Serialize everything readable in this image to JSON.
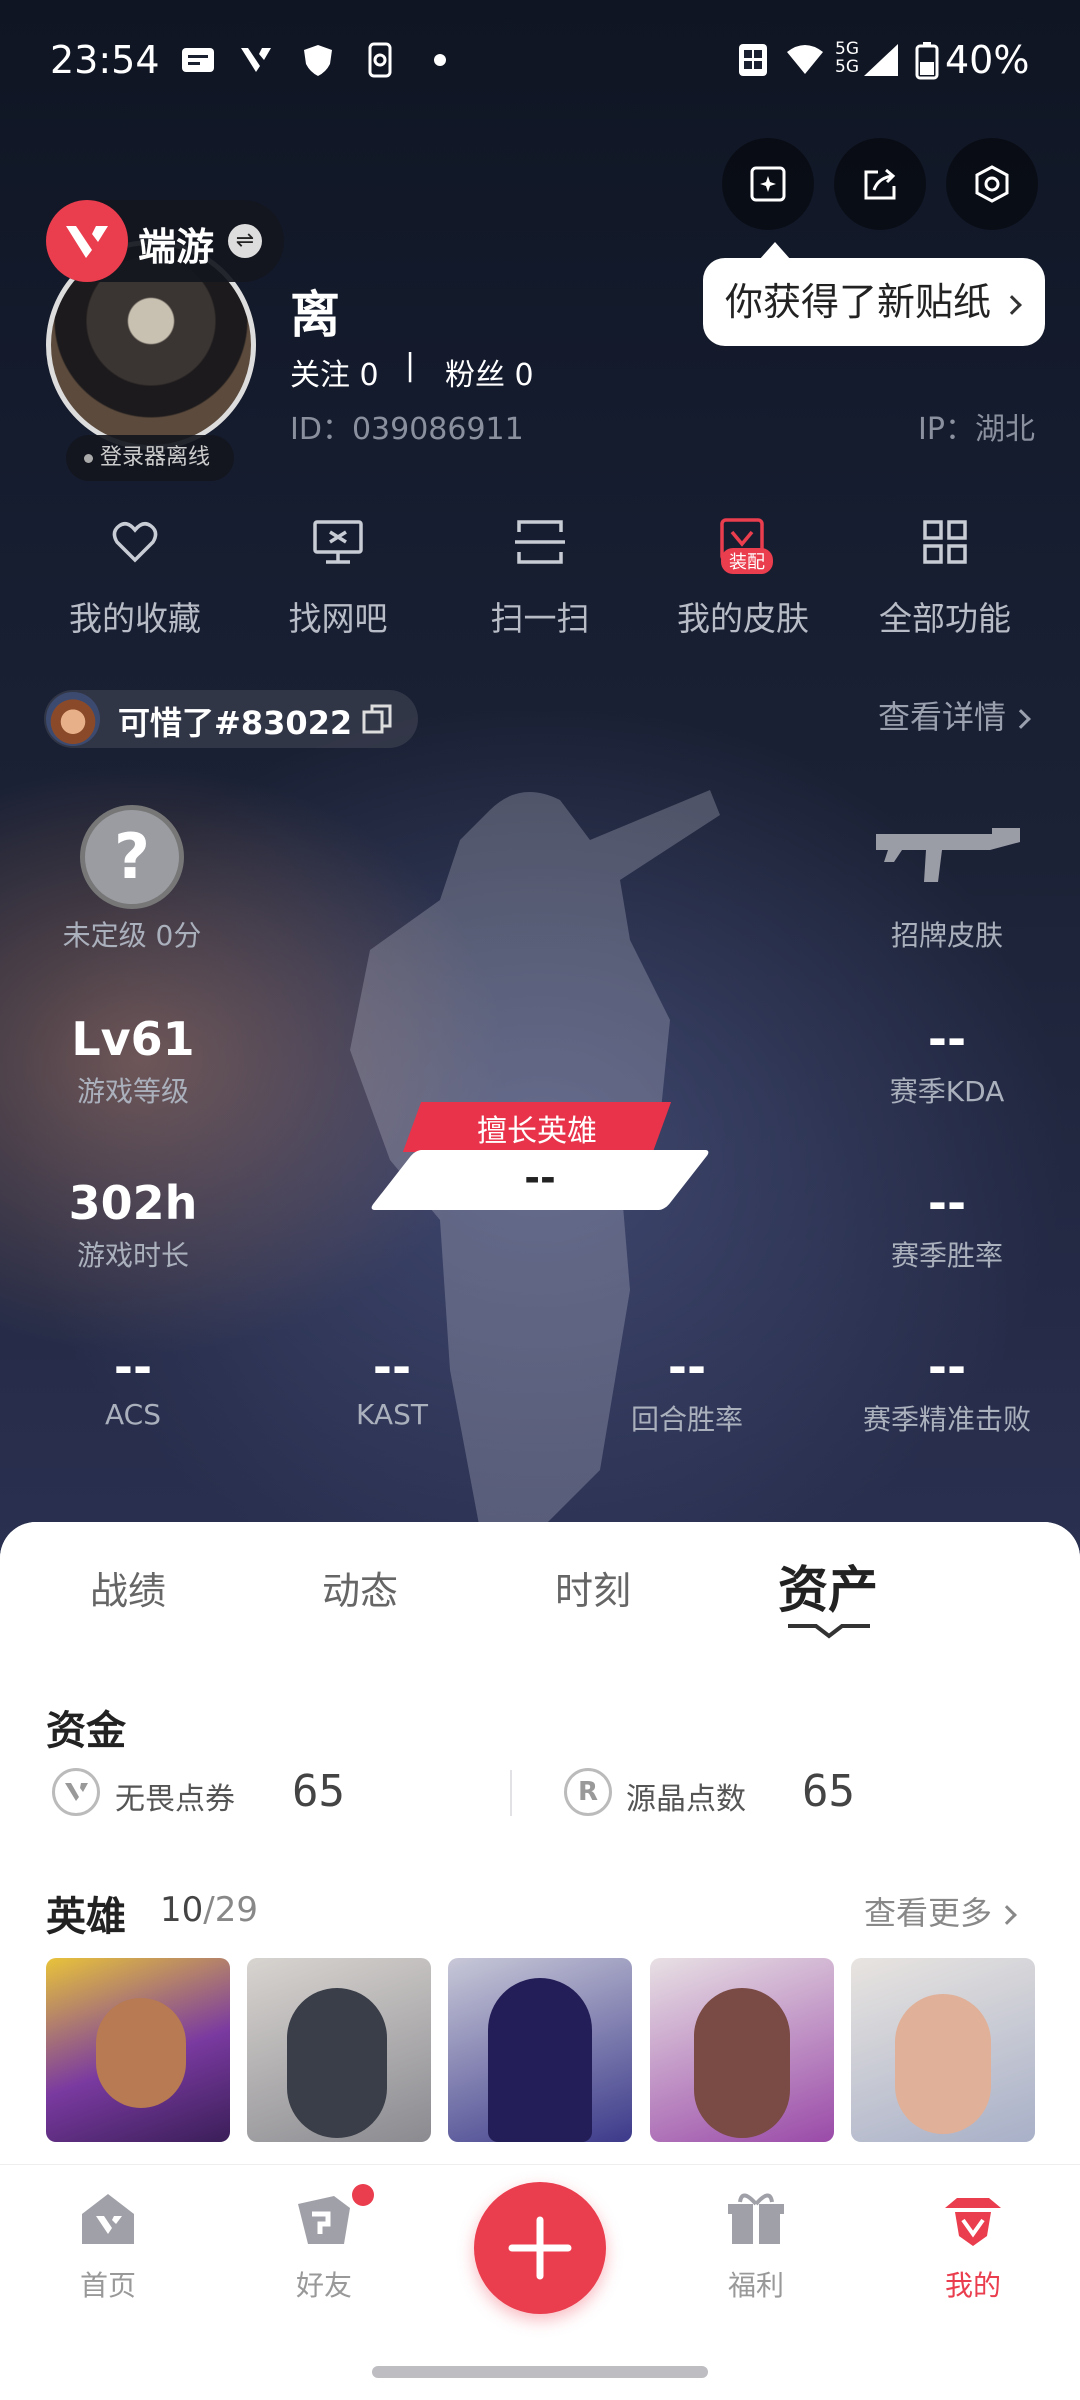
{
  "status_bar": {
    "time": "23:54",
    "battery": "40%",
    "network": "5G"
  },
  "profile": {
    "mode_badge": "端游",
    "name": "离",
    "follow": "关注 0",
    "separator": "|",
    "fans": "粉丝 0",
    "id": "ID：039086911",
    "ip": "IP：湖北",
    "status": "登录器离线"
  },
  "tooltip": "你获得了新贴纸",
  "quick_actions": [
    {
      "label": "我的收藏",
      "icon": "heart-icon"
    },
    {
      "label": "找网吧",
      "icon": "monitor-icon"
    },
    {
      "label": "扫一扫",
      "icon": "scan-icon"
    },
    {
      "label": "我的皮肤",
      "icon": "skin-icon",
      "badge": "装配"
    },
    {
      "label": "全部功能",
      "icon": "grid-icon"
    }
  ],
  "game_account": {
    "name": "可惜了#83022",
    "details_link": "查看详情"
  },
  "stats": {
    "rank": "未定级 0分",
    "signature_skin": "招牌皮肤",
    "level_value": "Lv61",
    "level_label": "游戏等级",
    "kda_value": "--",
    "kda_label": "赛季KDA",
    "hours_value": "302h",
    "hours_label": "游戏时长",
    "winrate_value": "--",
    "winrate_label": "赛季胜率",
    "best_hero_tag": "擅长英雄",
    "best_hero_value": "--",
    "acs_value": "--",
    "acs_label": "ACS",
    "kast_value": "--",
    "kast_label": "KAST",
    "round_value": "--",
    "round_label": "回合胜率",
    "precise_value": "--",
    "precise_label": "赛季精准击败"
  },
  "tabs": [
    "战绩",
    "动态",
    "时刻",
    "资产"
  ],
  "assets": {
    "funds_title": "资金",
    "vp_label": "无畏点券",
    "vp_value": "65",
    "rp_label": "源晶点数",
    "rp_value": "65",
    "heroes_title": "英雄",
    "heroes_owned": "10",
    "heroes_slash": "/",
    "heroes_total": "29",
    "more_link": "查看更多"
  },
  "bottom_nav": [
    {
      "label": "首页",
      "icon": "home-icon"
    },
    {
      "label": "好友",
      "icon": "friends-icon"
    },
    {
      "label": "",
      "icon": "add-icon"
    },
    {
      "label": "福利",
      "icon": "gift-icon"
    },
    {
      "label": "我的",
      "icon": "profile-icon"
    }
  ],
  "colors": {
    "accent": "#ea3d4d",
    "bg_dark": "#141b2d"
  }
}
